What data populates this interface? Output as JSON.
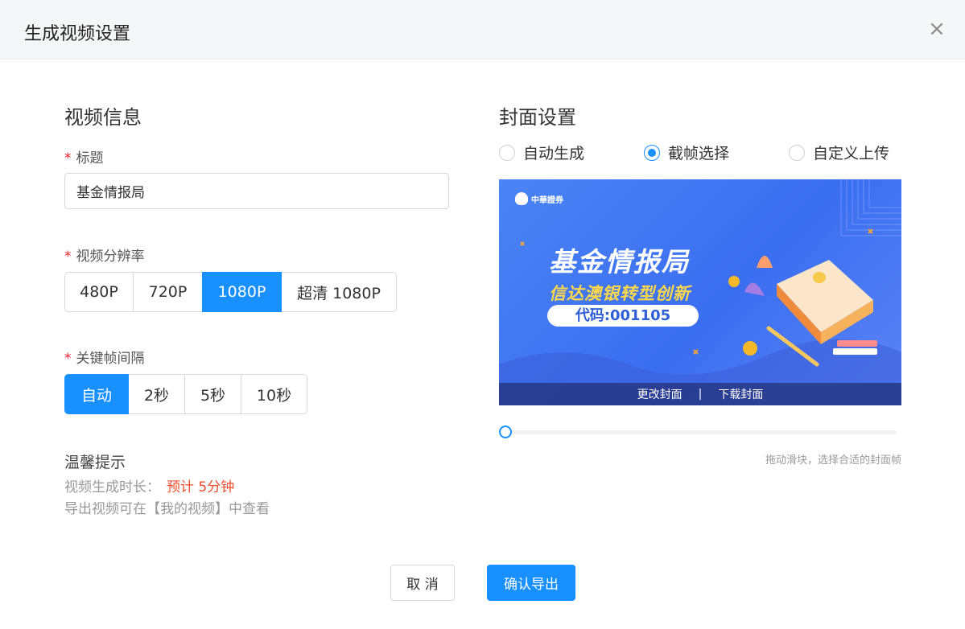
{
  "dialog": {
    "title": "生成视频设置",
    "close_icon": "×"
  },
  "video_info": {
    "section_title": "视频信息",
    "title_label": "标题",
    "title_value": "基金情报局",
    "resolution_label": "视频分辨率",
    "resolution_options": [
      "480P",
      "720P",
      "1080P",
      "超清 1080P"
    ],
    "resolution_selected": "1080P",
    "keyframe_label": "关键帧间隔",
    "keyframe_options": [
      "自动",
      "2秒",
      "5秒",
      "10秒"
    ],
    "keyframe_selected": "自动",
    "required_mark": "*"
  },
  "tips": {
    "title": "温馨提示",
    "duration_label": "视频生成时长：",
    "duration_value": "预计 5分钟",
    "export_note": "导出视频可在【我的视频】中查看"
  },
  "cover": {
    "section_title": "封面设置",
    "options": [
      "自动生成",
      "截帧选择",
      "自定义上传"
    ],
    "selected": "截帧选择",
    "preview": {
      "brand": "中華證券",
      "main_title": "基金情报局",
      "subtitle": "信达澳银转型创新",
      "code": "代码:001105"
    },
    "change_label": "更改封面",
    "separator": "|",
    "download_label": "下载封面",
    "slider_value": 0,
    "slider_hint": "拖动滑块，选择合适的封面帧"
  },
  "footer": {
    "cancel_label": "取 消",
    "confirm_label": "确认导出"
  },
  "colors": {
    "primary": "#1890ff",
    "accent": "#f04c2e",
    "required": "#f5222d"
  }
}
